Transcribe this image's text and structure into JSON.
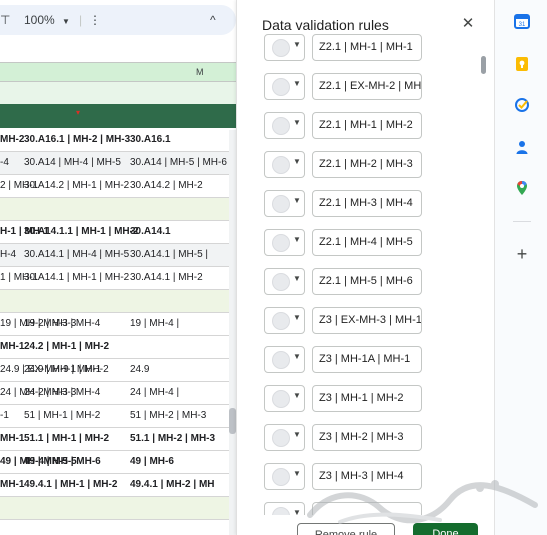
{
  "toolbar": {
    "zoom": "100%",
    "more_label": "⋮",
    "collapse_label": "^"
  },
  "sheet": {
    "column_letter": "M",
    "rows": [
      {
        "cells": [
          "MH-2",
          "30.A16.1 | MH-2 | MH-3",
          "30.A16.1"
        ],
        "style": "bold"
      },
      {
        "cells": [
          "-4",
          "30.A14 | MH-4 | MH-5",
          "30.A14 | MH-5 | MH-6"
        ],
        "style": "shade"
      },
      {
        "cells": [
          "2 | MH-1",
          "30.A14.2 | MH-1 | MH-2",
          "30.A14.2 | MH-2"
        ],
        "style": ""
      },
      {
        "cells": [
          "",
          "",
          ""
        ],
        "style": "tint"
      },
      {
        "cells": [
          "H-1 | MH-1",
          "30.A14.1.1 | MH-1 | MH-2",
          "30.A14.1"
        ],
        "style": "bold"
      },
      {
        "cells": [
          "H-4",
          "30.A14.1 | MH-4 | MH-5",
          "30.A14.1 | MH-5 |"
        ],
        "style": "shade"
      },
      {
        "cells": [
          "1 | MH-1",
          "30.A14.1 | MH-1 | MH-2",
          "30.A14.1 | MH-2"
        ],
        "style": ""
      },
      {
        "cells": [
          "",
          "",
          ""
        ],
        "style": "tint"
      },
      {
        "cells": [
          "19 | MH-2 | MH-3",
          "19 | MH-3 | MH-4",
          "19 | MH-4 |"
        ],
        "style": ""
      },
      {
        "cells": [
          "MH-1",
          "24.2 | MH-1 | MH-2",
          ""
        ],
        "style": "bold"
      },
      {
        "cells": [
          "24.9 | EX-MH-9 | MH-1",
          "24.9 | MH-1 | MH-2",
          "24.9"
        ],
        "style": ""
      },
      {
        "cells": [
          "24 | MH-2 | MH-3",
          "24 | MH-3 | MH-4",
          "24 | MH-4 |"
        ],
        "style": ""
      },
      {
        "cells": [
          "-1",
          "51 | MH-1 | MH-2",
          "51 | MH-2 | MH-3"
        ],
        "style": ""
      },
      {
        "cells": [
          "MH-1",
          "51.1 | MH-1 | MH-2",
          "51.1 | MH-2 | MH-3"
        ],
        "style": "bold"
      },
      {
        "cells": [
          "49 | MH-4 | MH-5",
          "49 | MH-5 | MH-6",
          "49 | MH-6"
        ],
        "style": "bold"
      },
      {
        "cells": [
          "MH-1",
          "49.4.1 | MH-1 | MH-2",
          "49.4.1 | MH-2 | MH"
        ],
        "style": "bold"
      },
      {
        "cells": [
          "",
          "",
          ""
        ],
        "style": "tint"
      }
    ]
  },
  "panel": {
    "title": "Data validation rules",
    "close_icon": "close-icon",
    "rules": [
      {
        "label": "Z2.1 | MH-1 | MH-1"
      },
      {
        "label": "Z2.1 | EX-MH-2 | MH-"
      },
      {
        "label": "Z2.1 | MH-1 | MH-2"
      },
      {
        "label": "Z2.1 | MH-2 | MH-3"
      },
      {
        "label": "Z2.1 | MH-3 | MH-4"
      },
      {
        "label": "Z2.1 | MH-4 | MH-5"
      },
      {
        "label": "Z2.1 | MH-5 | MH-6"
      },
      {
        "label": "Z3 | EX-MH-3 | MH-1/"
      },
      {
        "label": "Z3 | MH-1A | MH-1"
      },
      {
        "label": "Z3 | MH-1 | MH-2"
      },
      {
        "label": "Z3 | MH-2 | MH-3"
      },
      {
        "label": "Z3 | MH-3 | MH-4"
      },
      {
        "label": ""
      }
    ],
    "remove_label": "Remove rule",
    "done_label": "Done"
  },
  "rail": {
    "icons": [
      "calendar-icon",
      "keep-icon",
      "tasks-icon",
      "contacts-icon",
      "maps-icon"
    ],
    "colors": {
      "calendar": "#1a73e8",
      "keep": "#fbbc04",
      "tasks": "#1a73e8",
      "contacts": "#1a73e8",
      "maps": "#34a853"
    }
  }
}
